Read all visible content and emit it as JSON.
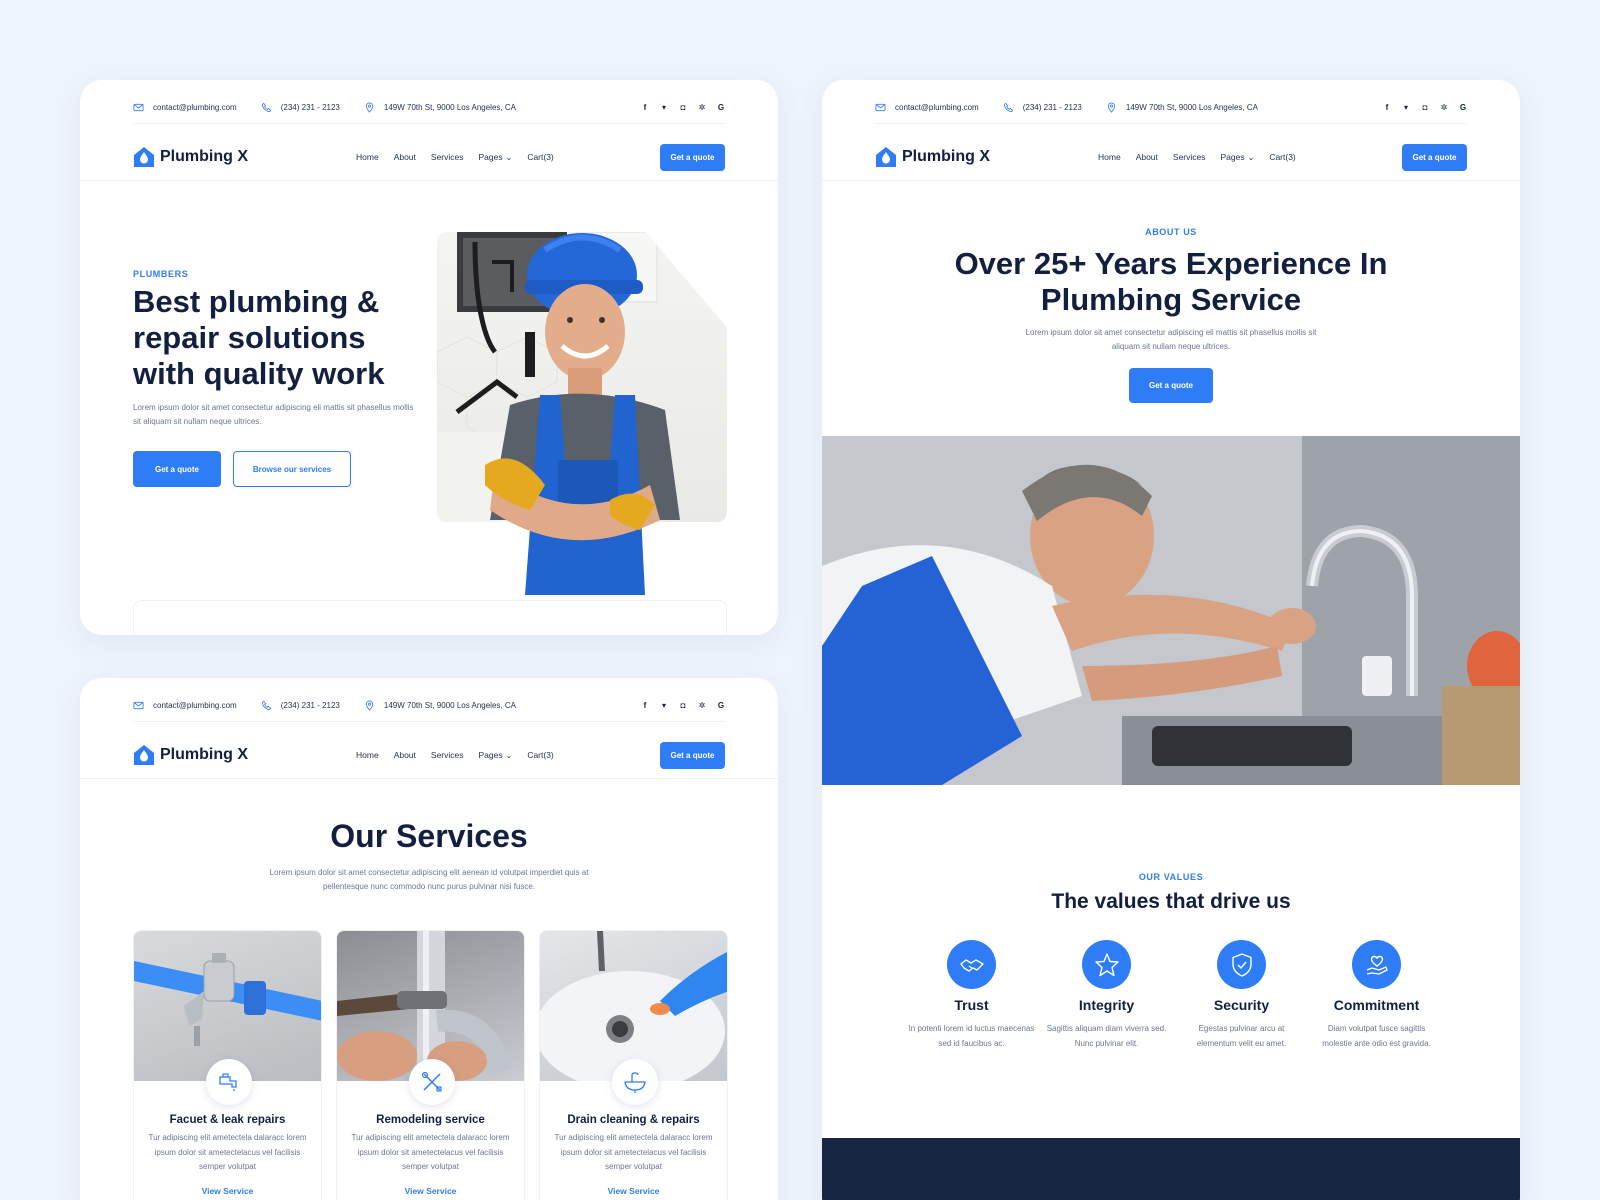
{
  "topbar": {
    "email": "contact@plumbing.com",
    "phone": "(234) 231 - 2123",
    "address": "149W 70th St, 9000 Los Angeles, CA",
    "social": [
      "f",
      "t",
      "ig",
      "yelp",
      "G"
    ]
  },
  "nav": {
    "logo": "Plumbing X",
    "items": [
      "Home",
      "About",
      "Services",
      "Pages",
      "Cart(3)"
    ],
    "cta": "Get a quote"
  },
  "hero": {
    "eyebrow": "PLUMBERS",
    "title": "Best plumbing & repair solutions with quality work",
    "description": "Lorem ipsum dolor sit amet consectetur adipiscing eli mattis sit phasellus mollis sit aliquam sit nullam neque ultrices.",
    "primary_button": "Get a quote",
    "secondary_button": "Browse our services"
  },
  "services": {
    "title": "Our Services",
    "description": "Lorem ipsum dolor sit amet consectetur adipiscing elit aenean id volutpat imperdiet quis at pellentesque nunc commodo nunc purus pulvinar nisi fusce.",
    "cards": [
      {
        "name": "Facuet & leak repairs",
        "text": "Tur adipiscing elit ametectela dalaracc lorem ipsum dolor sit ametectelacus vel facilisis semper volutpat",
        "link": "View Service",
        "icon": "faucet-icon"
      },
      {
        "name": "Remodeling service",
        "text": "Tur adipiscing elit ametectela dalaracc lorem ipsum dolor sit ametectelacus vel facilisis semper volutpat",
        "link": "View Service",
        "icon": "tools-icon"
      },
      {
        "name": "Drain cleaning & repairs",
        "text": "Tur adipiscing elit ametectela dalaracc lorem ipsum dolor sit ametectelacus vel facilisis semper volutpat",
        "link": "View Service",
        "icon": "sink-icon"
      }
    ]
  },
  "about": {
    "eyebrow": "ABOUT US",
    "title": "Over 25+ Years Experience In Plumbing Service",
    "description": "Lorem ipsum dolor sit amet consectetur adipiscing eli mattis sit phasellus mollis sit aliquam sit nullam neque ultrices.",
    "button": "Get a quote"
  },
  "values": {
    "eyebrow": "OUR VALUES",
    "title": "The values that drive us",
    "items": [
      {
        "name": "Trust",
        "text": "In potenti lorem id luctus maecenas sed id faucibus ac.",
        "icon": "handshake-icon"
      },
      {
        "name": "Integrity",
        "text": "Sagittis aliquam diam viverra sed. Nunc pulvinar elit.",
        "icon": "star-icon"
      },
      {
        "name": "Security",
        "text": "Egestas pulvinar arcu at elementum velit eu amet.",
        "icon": "shield-icon"
      },
      {
        "name": "Commitment",
        "text": "Diam volutpat fusce sagittis molestie ante odio est gravida.",
        "icon": "heart-hand-icon"
      }
    ]
  },
  "colors": {
    "accent": "#2f7df6",
    "heading": "#121f3e",
    "background": "#eef4fc",
    "footer": "#172743"
  }
}
